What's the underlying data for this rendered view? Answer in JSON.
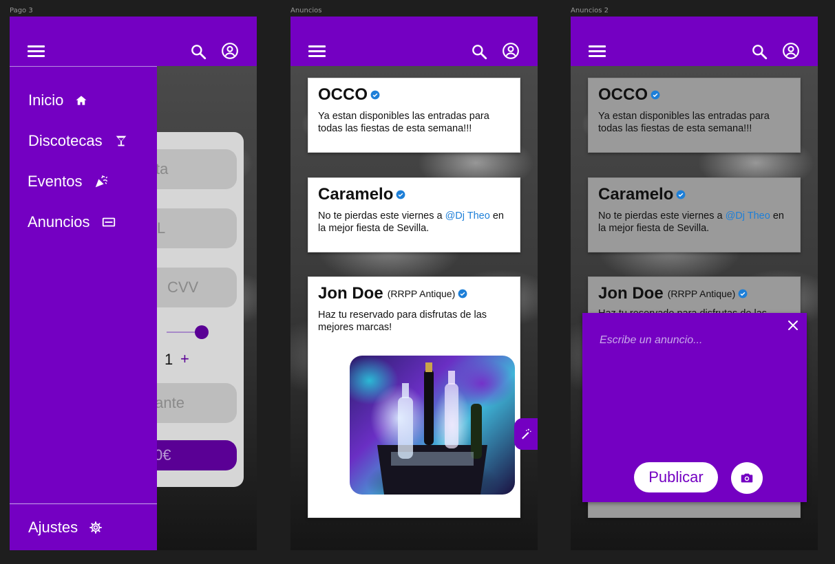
{
  "frames": {
    "pago3": {
      "label": "Pago 3"
    },
    "anuncios": {
      "label": "Anuncios"
    },
    "anuncios2": {
      "label": "Anuncios 2"
    }
  },
  "colors": {
    "primary": "#7400c2",
    "mention": "#1d7fd8",
    "verified": "#1d7fd8"
  },
  "appbar": {
    "menu_icon": "menu-icon",
    "search_icon": "search-icon",
    "account_icon": "account-circle-icon"
  },
  "drawer": {
    "items": [
      {
        "label": "Inicio",
        "icon": "home-icon"
      },
      {
        "label": "Discotecas",
        "icon": "cocktail-icon"
      },
      {
        "label": "Eventos",
        "icon": "party-popper-icon"
      },
      {
        "label": "Anuncios",
        "icon": "card-icon"
      }
    ],
    "settings": {
      "label": "Ajustes",
      "icon": "gear-icon"
    }
  },
  "payment_form": {
    "field1": "ta",
    "field2": "L",
    "cvv": "CVV",
    "quantity": "1",
    "plus": "+",
    "field3": "inante",
    "pay_button": "0€"
  },
  "posts": [
    {
      "author": "OCCO",
      "role": "",
      "text": "Ya estan disponibles las entradas para todas las fiestas de esta semana!!!"
    },
    {
      "author": "Caramelo",
      "role": "",
      "text_before": "No te pierdas este viernes a ",
      "mention": "@Dj Theo",
      "text_after": " en la mejor fiesta de Sevilla."
    },
    {
      "author": "Jon Doe",
      "role": "(RRPP Antique)",
      "text": "Haz tu reservado para disfrutas de las mejores marcas!"
    }
  ],
  "compose": {
    "placeholder": "Escribe un anuncio...",
    "publish_label": "Publicar",
    "camera_icon": "camera-icon",
    "close_icon": "close-icon",
    "partial_text": "Haz tu reservado para disfrutas de las"
  }
}
